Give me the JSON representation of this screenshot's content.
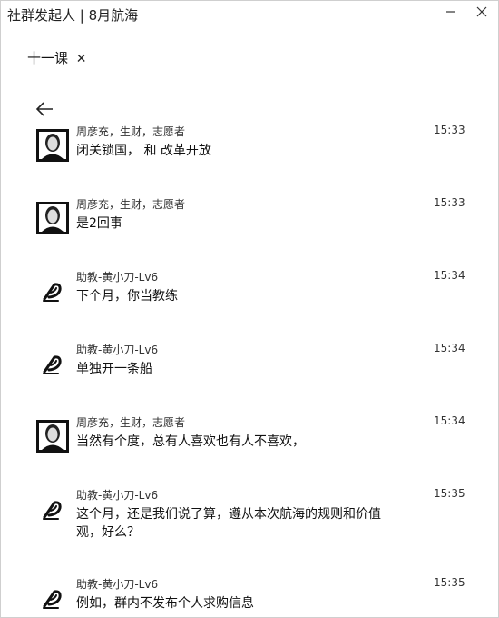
{
  "window": {
    "title": "社群发起人 | 8月航海",
    "minimize_icon": "minimize-icon",
    "close_icon": "close-icon"
  },
  "tab": {
    "label": "十一课",
    "close_glyph": "✕"
  },
  "nav": {
    "back_icon": "back-arrow-icon"
  },
  "messages": [
    {
      "sender": "周彦充，生财，志愿者",
      "time": "15:33",
      "text": "闭关锁国， 和 改革开放",
      "avatar": "portrait-avatar"
    },
    {
      "sender": "周彦充，生财，志愿者",
      "time": "15:33",
      "text": "是2回事",
      "avatar": "portrait-avatar"
    },
    {
      "sender": "助教-黄小刀-Lv6",
      "time": "15:34",
      "text": "下个月，你当教练",
      "avatar": "logo-avatar"
    },
    {
      "sender": "助教-黄小刀-Lv6",
      "time": "15:34",
      "text": "单独开一条船",
      "avatar": "logo-avatar"
    },
    {
      "sender": "周彦充，生财，志愿者",
      "time": "15:34",
      "text": "当然有个度，总有人喜欢也有人不喜欢，",
      "avatar": "portrait-avatar"
    },
    {
      "sender": "助教-黄小刀-Lv6",
      "time": "15:35",
      "text": "这个月，还是我们说了算，遵从本次航海的规则和价值观，好么？",
      "avatar": "logo-avatar"
    },
    {
      "sender": "助教-黄小刀-Lv6",
      "time": "15:35",
      "text": "例如，群内不发布个人求购信息",
      "avatar": "logo-avatar"
    }
  ]
}
